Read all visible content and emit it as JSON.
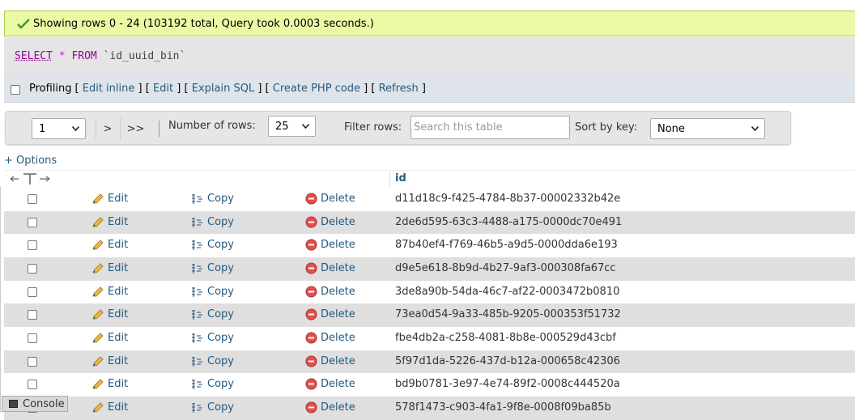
{
  "status": {
    "message": "Showing rows 0 - 24 (103192 total, Query took 0.0003 seconds.)"
  },
  "sql": {
    "select": "SELECT",
    "star": "*",
    "from": "FROM",
    "table": "`id_uuid_bin`"
  },
  "profiling": {
    "label": "Profiling",
    "lb": "[",
    "rb": "]",
    "links": [
      "Edit inline",
      "Edit",
      "Explain SQL",
      "Create PHP code",
      "Refresh"
    ]
  },
  "nav": {
    "page_value": "1",
    "next": ">",
    "last": ">>",
    "rows_label": "Number of rows:",
    "rows_value": "25",
    "filter_label": "Filter rows:",
    "filter_placeholder": "Search this table",
    "sort_label": "Sort by key:",
    "sort_value": "None"
  },
  "options_link": "+ Options",
  "table": {
    "column": "id",
    "actions": {
      "edit": "Edit",
      "copy": "Copy",
      "delete": "Delete"
    },
    "rows": [
      "d11d18c9-f425-4784-8b37-00002332b42e",
      "2de6d595-63c3-4488-a175-0000dc70e491",
      "87b40ef4-f769-46b5-a9d5-0000dda6e193",
      "d9e5e618-8b9d-4b27-9af3-000308fa67cc",
      "3de8a90b-54da-46c7-af22-0003472b0810",
      "73ea0d54-9a33-485b-9205-000353f51732",
      "fbe4db2a-c258-4081-8b8e-000529d43cbf",
      "5f97d1da-5226-437d-b12a-000658c42306",
      "bd9b0781-3e97-4e74-89f2-0008c444520a",
      "578f1473-c903-4fa1-9f8e-0008f09ba85b"
    ]
  },
  "console": {
    "label": "Console"
  },
  "colors": {
    "link": "#235a81",
    "success_bg": "#ebf8a4",
    "delete_red": "#e05050"
  }
}
